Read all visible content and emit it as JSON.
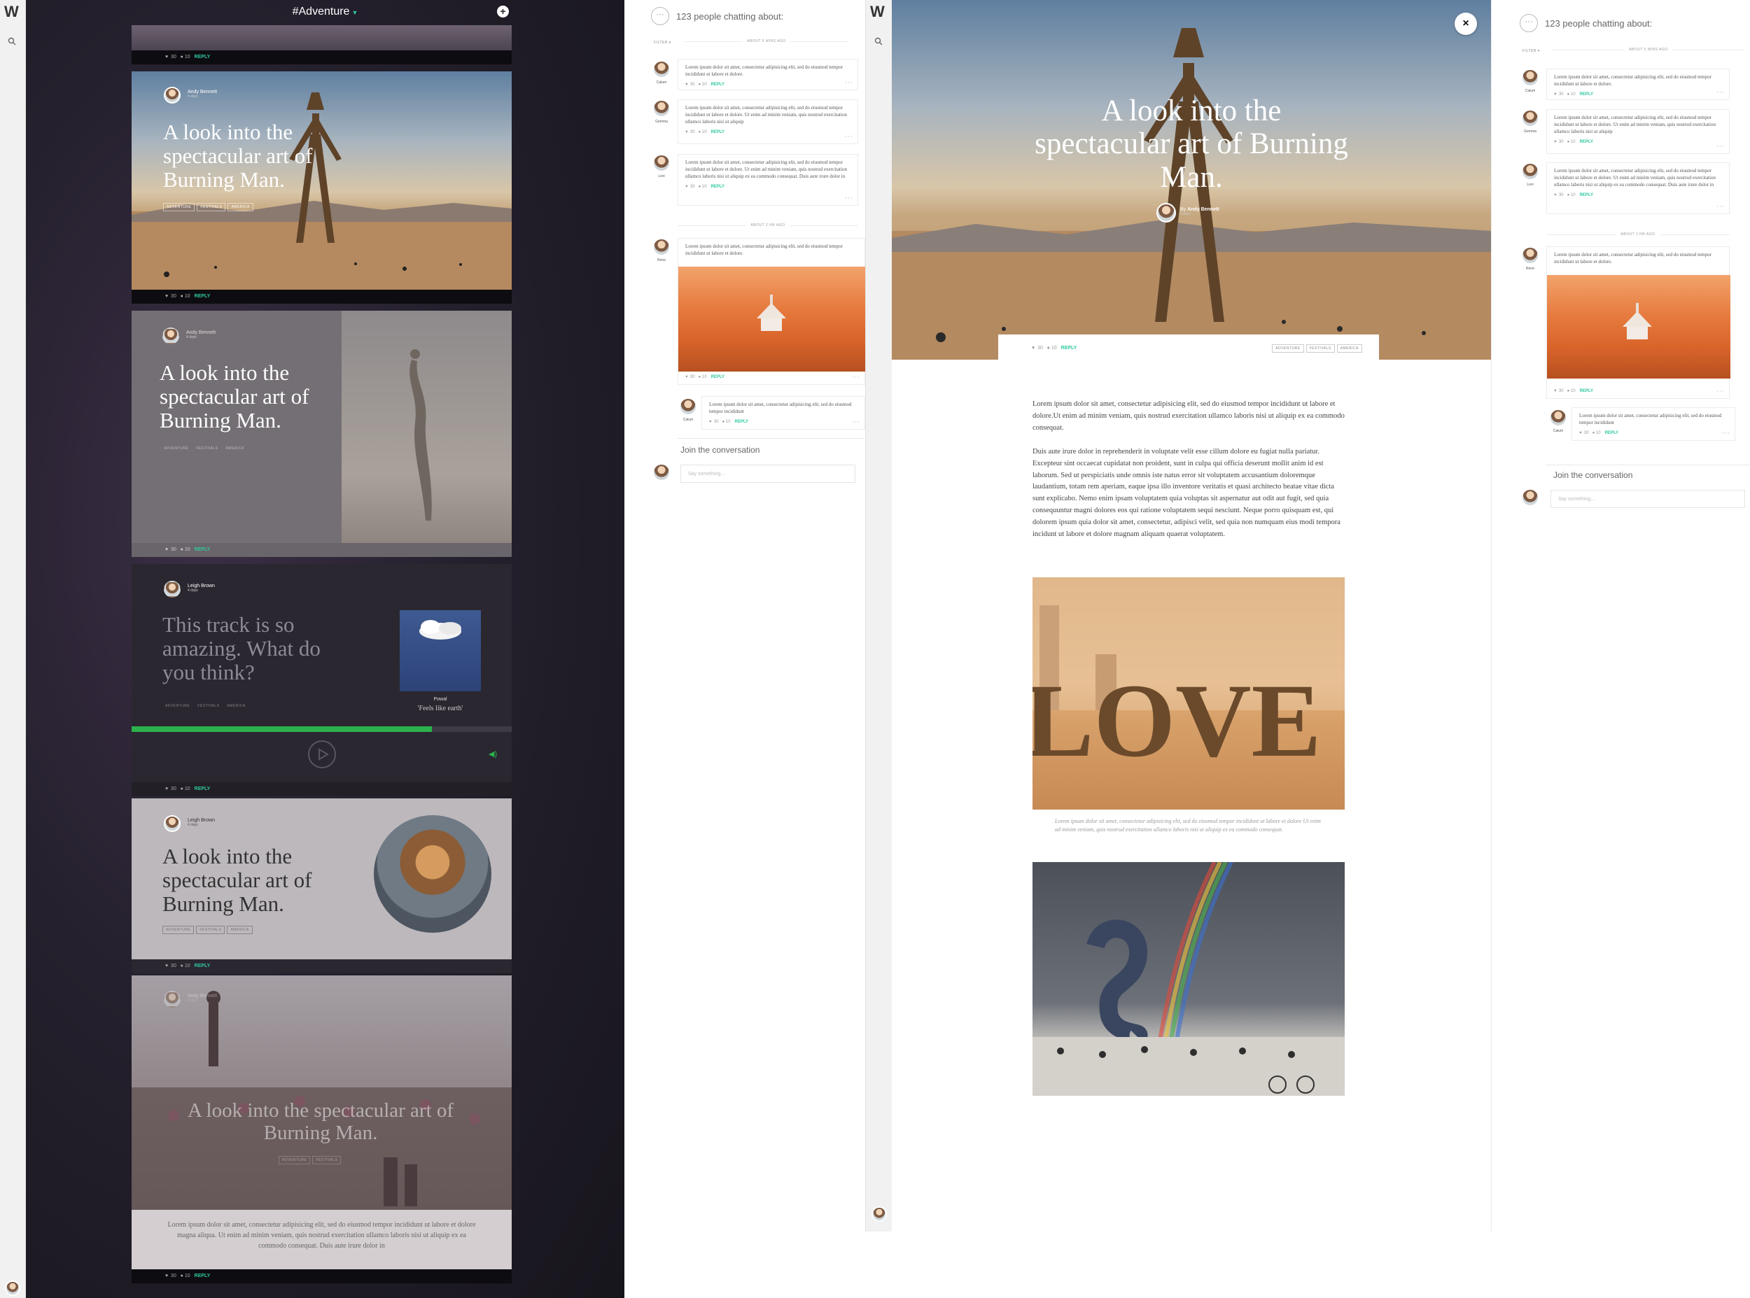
{
  "feed": {
    "channel": "#Adventure",
    "plus_label": "+",
    "footer": {
      "likes": "30",
      "comments": "10",
      "reply": "REPLY"
    },
    "cards": [
      {
        "author": "Andy Bennett",
        "time": "4 days",
        "title": "A look into the spectacular art of Burning Man.",
        "tags": [
          "ADVENTURE",
          "FESTIVALS",
          "AMERICA"
        ]
      },
      {
        "author": "Andy Bennett",
        "time": "4 days",
        "title": "A look into the spectacular art of Burning Man.",
        "tags": [
          "ADVENTURE",
          "FESTIVALS",
          "AMERICA"
        ]
      },
      {
        "author": "Leigh Brown",
        "time": "4 days",
        "title": "This track is so amazing. What do you think?",
        "tags": [
          "ADVENTURE",
          "FESTIVALS",
          "AMERICA"
        ],
        "artist": "Powal",
        "track": "'Feels like earth'"
      },
      {
        "author": "Leigh Brown",
        "time": "4 days",
        "title": "A look into the spectacular art of Burning Man.",
        "tags": [
          "ADVENTURE",
          "FESTIVALS",
          "AMERICA"
        ]
      },
      {
        "author": "Andy Bennett",
        "time": "4 days",
        "title": "A look into the spectacular art of Burning Man.",
        "tags": [
          "ADVENTURE",
          "FESTIVALS"
        ],
        "excerpt": "Lorem ipsum dolor sit amet, consectetur adipisicing elit, sed do eiusmod tempor incididunt ut labore et dolore magna aliqua. Ut enim ad minim veniam, quis nostrud exercitation ullamco laboris nisi ut aliquip ex ea commodo consequat. Duis aute irure dolor in"
      }
    ]
  },
  "chat": {
    "title": "123 people chatting about:",
    "filter": "FILTER ▾",
    "group1_label": "ABOUT 5 MINS AGO",
    "group2_label": "ABOUT 2 HR AGO",
    "comments": [
      {
        "name": "Calum",
        "text": "Lorem ipsum dolor sit amet, consectetur adipisicing elit, sed do eiusmod tempor incididunt ut labore et dolore."
      },
      {
        "name": "Gemma",
        "text": "Lorem ipsum dolor sit amet, consectetur adipisicing elit, sed do eiusmod tempor incididunt ut labore et dolore. Ut enim ad minim veniam, quis nostrud exercitation ullamco laboris nisi ut aliquip"
      },
      {
        "name": "Lexi",
        "text": "Lorem ipsum dolor sit amet, consectetur adipisicing elit, sed do eiusmod tempor incididunt ut labore et dolore. Ut enim ad minim veniam, quis nostrud exercitation ullamco laboris nisi ut aliquip ex ea commodo consequat. Duis aute irure dolor in"
      },
      {
        "name": "Rene",
        "text": "Lorem ipsum dolor sit amet, consectetur adipisicing elit, sed do eiusmod tempor incididunt ut labore et dolore."
      },
      {
        "name": "Calum",
        "text": "Lorem ipsum dolor sit amet, consectetur adipisicing elit, sed do eiusmod tempor incididunt"
      }
    ],
    "meta": {
      "likes": "30",
      "comments": "10",
      "reply": "REPLY"
    },
    "join": "Join the conversation",
    "placeholder": "Say something..."
  },
  "article": {
    "title": "A look into the spectacular art of Burning Man.",
    "by": "By",
    "author": "Andy Bennett",
    "time": "4 days",
    "likes": "30",
    "comments": "10",
    "reply": "REPLY",
    "tags": [
      "ADVENTURE",
      "FESTIVALS",
      "AMERICA"
    ],
    "close": "×",
    "p1": "Lorem ipsum dolor sit amet, consectetur adipisicing elit, sed do eiusmod tempor incididunt ut labore et dolore.Ut enim ad minim veniam, quis nostrud exercitation ullamco laboris nisi ut aliquip ex ea commodo consequat.",
    "p2": "Duis aute irure dolor in reprehenderit in voluptate velit esse cillum dolore eu fugiat nulla pariatur. Excepteur sint occaecat cupidatat non proident, sunt in culpa qui officia deserunt mollit anim id est laborum. Sed ut perspiciatis unde omnis iste natus error sit voluptatem accusantium doloremque laudantium, totam rem aperiam, eaque ipsa illo inventore veritatis et quasi architecto beatae vitae dicta sunt explicabo. Nemo enim ipsam voluptatem quia voluptas sit aspernatur aut odit aut fugit, sed quia consequuntur magni dolores eos qui ratione voluptatem sequi nesciunt. Neque porro quisquam est, qui dolorem ipsum quia dolor sit amet, consectetur, adipisci velit, sed quia non numquam eius modi tempora incidunt ut labore et dolore magnam aliquam quaerat voluptatem.",
    "love_text": "LOVE",
    "caption": "Lorem ipsum dolor sit amet, consectetur adipisicing elit, sed do eiusmod tempor incididunt ut labore et dolore Ut enim ad minim veniam, quis nostrud exercitation ullamco laboris nisi ut aliquip ex ea commodo consequat."
  },
  "colors": {
    "accent": "#2dc9a0",
    "progress": "#2bb24c"
  },
  "player": {
    "progress_fraction": 0.79
  }
}
